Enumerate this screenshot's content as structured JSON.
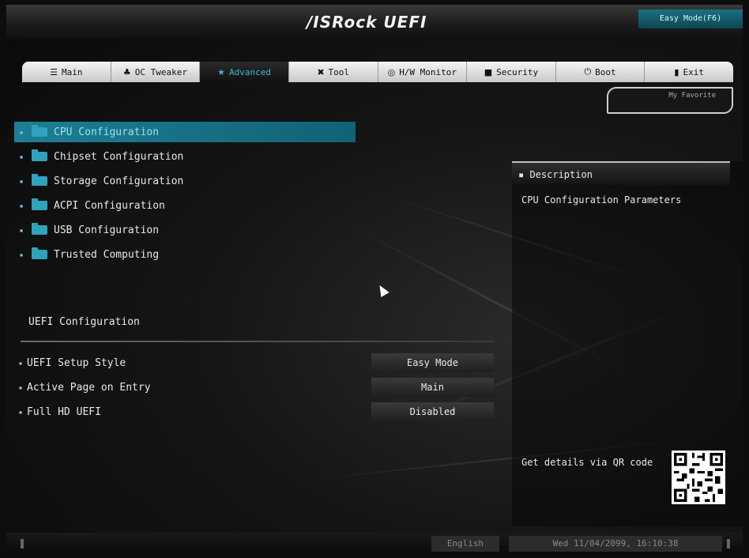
{
  "header": {
    "logo": "/ISRock UEFI",
    "easy_mode_button": "Easy Mode(F6)"
  },
  "tabs": [
    {
      "label": "Main",
      "icon": "menu-icon"
    },
    {
      "label": "OC Tweaker",
      "icon": "wrench-icon"
    },
    {
      "label": "Advanced",
      "icon": "star-icon",
      "active": true
    },
    {
      "label": "Tool",
      "icon": "tools-icon"
    },
    {
      "label": "H/W Monitor",
      "icon": "monitor-icon"
    },
    {
      "label": "Security",
      "icon": "shield-icon"
    },
    {
      "label": "Boot",
      "icon": "power-icon"
    },
    {
      "label": "Exit",
      "icon": "exit-icon"
    }
  ],
  "my_favorite": "My Favorite",
  "menu_items": [
    {
      "label": "CPU Configuration",
      "selected": true
    },
    {
      "label": "Chipset Configuration"
    },
    {
      "label": "Storage Configuration"
    },
    {
      "label": "ACPI Configuration"
    },
    {
      "label": "USB Configuration"
    },
    {
      "label": "Trusted Computing"
    }
  ],
  "section_title": "UEFI Configuration",
  "settings": [
    {
      "label": "UEFI Setup Style",
      "value": "Easy Mode"
    },
    {
      "label": "Active Page on Entry",
      "value": "Main"
    },
    {
      "label": "Full HD UEFI",
      "value": "Disabled"
    }
  ],
  "description": {
    "heading": "Description",
    "text": "CPU Configuration Parameters",
    "qr_text": "Get details via QR code"
  },
  "footer": {
    "language": "English",
    "datetime": "Wed 11/04/2099, 16:10:38"
  },
  "colors": {
    "accent": "#1d7f95",
    "accent_text": "#3ab8d0",
    "background": "#0d0d0d"
  }
}
